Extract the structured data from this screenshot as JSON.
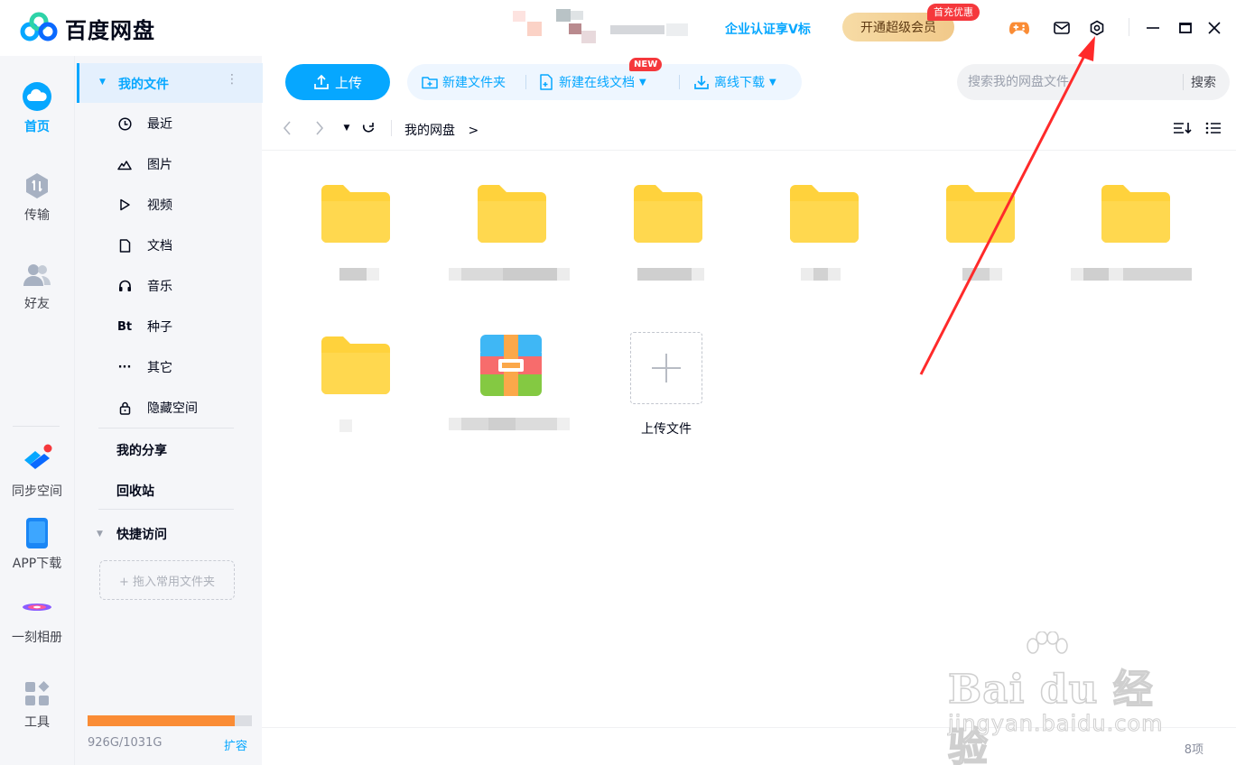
{
  "app": {
    "brand": "百度网盘",
    "enterprise_link": "企业认证享V标",
    "vip_button": "开通超级会员",
    "vip_badge": "首充优惠",
    "title_icons": [
      "game-icon",
      "mail-icon",
      "settings-icon",
      "minimize-icon",
      "maximize-icon",
      "close-icon"
    ]
  },
  "left_nav": [
    {
      "label": "首页",
      "icon": "cloud-icon",
      "active": true
    },
    {
      "label": "传输",
      "icon": "transfer-icon",
      "active": false
    },
    {
      "label": "好友",
      "icon": "friends-icon",
      "active": false
    },
    {
      "label": "同步空间",
      "icon": "sync-icon",
      "active": false
    },
    {
      "label": "APP下载",
      "icon": "phone-icon",
      "active": false
    },
    {
      "label": "一刻相册",
      "icon": "album-icon",
      "active": false
    },
    {
      "label": "工具",
      "icon": "tools-icon",
      "active": false
    }
  ],
  "sidebar": {
    "my_files": "我的文件",
    "categories": [
      {
        "label": "最近",
        "icon": "clock-icon"
      },
      {
        "label": "图片",
        "icon": "image-icon"
      },
      {
        "label": "视频",
        "icon": "play-icon"
      },
      {
        "label": "文档",
        "icon": "document-icon"
      },
      {
        "label": "音乐",
        "icon": "headphones-icon"
      },
      {
        "label": "种子",
        "icon": "bt-icon",
        "glyph": "Bt"
      },
      {
        "label": "其它",
        "icon": "more-icon",
        "glyph": "···"
      },
      {
        "label": "隐藏空间",
        "icon": "lock-icon"
      }
    ],
    "my_share": "我的分享",
    "recycle": "回收站",
    "quick_access": "快捷访问",
    "quick_drop": "+ 拖入常用文件夹",
    "quota_text": "926G/1031G",
    "quota_used_fraction": 0.898,
    "expand_link": "扩容"
  },
  "toolbar": {
    "upload": "上传",
    "new_folder": "新建文件夹",
    "new_online_doc": "新建在线文档",
    "new_badge": "NEW",
    "offline_download": "离线下载",
    "search_placeholder": "搜索我的网盘文件",
    "search_button": "搜索"
  },
  "breadcrumb": {
    "path": "我的网盘",
    "separator": ">"
  },
  "files": {
    "items": [
      {
        "type": "folder"
      },
      {
        "type": "folder"
      },
      {
        "type": "folder"
      },
      {
        "type": "folder"
      },
      {
        "type": "folder"
      },
      {
        "type": "folder"
      },
      {
        "type": "folder"
      },
      {
        "type": "archive"
      }
    ],
    "upload_tile_label": "上传文件",
    "count": "8项"
  },
  "colors": {
    "accent": "#06a7ff",
    "folder": "#ffd23c",
    "vip_gold": "#f1c98a",
    "badge_red": "#f5383c",
    "quota_orange": "#fa8c35",
    "annotation_arrow": "#ff2a2a"
  },
  "watermark": {
    "main": "Bai du 经验",
    "sub": "jingyan.baidu.com"
  }
}
